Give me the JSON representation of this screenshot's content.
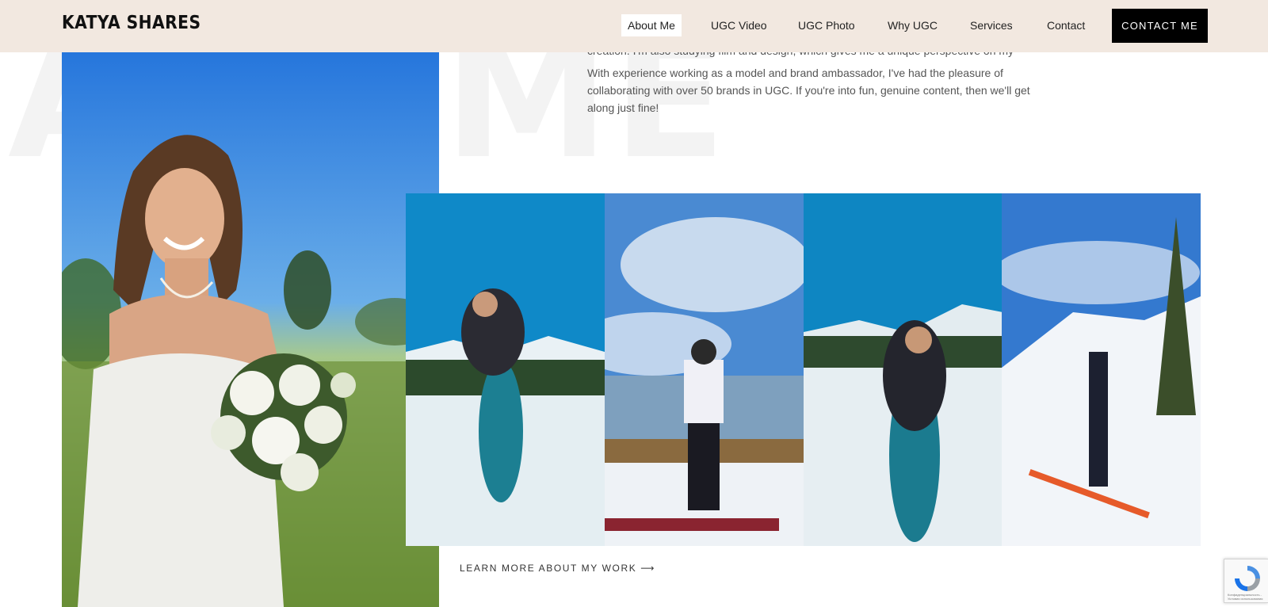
{
  "background_heading": {
    "left_word": "A",
    "right_word": "ME"
  },
  "header": {
    "logo": "KATYA SHARES",
    "nav": [
      {
        "label": "About Me",
        "active": true
      },
      {
        "label": "UGC Video",
        "active": false
      },
      {
        "label": "UGC Photo",
        "active": false
      },
      {
        "label": "Why UGC",
        "active": false
      },
      {
        "label": "Services",
        "active": false
      },
      {
        "label": "Contact",
        "active": false
      }
    ],
    "cta_label": "CONTACT ME"
  },
  "about": {
    "paragraph_1_tail": "creation. I'm also studying film and design, which gives me a unique perspective on my content.",
    "paragraph_2": "With experience working as a model and brand ambassador, I've had the pleasure of collaborating with over 50 brands in UGC. If you're into fun, genuine content, then we'll get along just fine!"
  },
  "learn_more": {
    "label": "LEARN MORE ABOUT MY WORK",
    "arrow": "⟶"
  },
  "recaptcha": {
    "caption": "Конфиденциальность - Условия использования"
  },
  "colors": {
    "header_bg": "#f2e8e0",
    "cta_bg": "#000000",
    "sky": "#1f8fd0"
  }
}
